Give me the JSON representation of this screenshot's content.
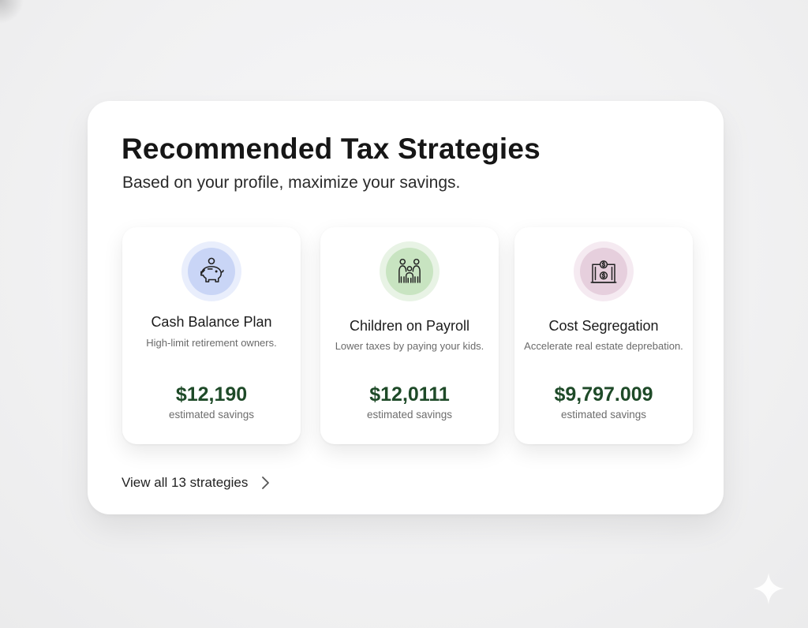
{
  "panel": {
    "title": "Recommended Tax Strategies",
    "subtitle": "Based on your profile, maximize your savings."
  },
  "strategies": [
    {
      "name": "Cash Balance Plan",
      "description": "High-limit retirement owners.",
      "amount": "$12,190",
      "caption": "estimated savings",
      "icon": "piggy-bank-icon",
      "accent": "#c9d5f6"
    },
    {
      "name": "Children on Payroll",
      "description": "Lower taxes by paying your kids.",
      "amount": "$12,0111",
      "caption": "estimated savings",
      "icon": "family-icon",
      "accent": "#c8e4c1"
    },
    {
      "name": "Cost Segregation",
      "description": "Accelerate real estate deprebation.",
      "amount": "$9,797.009",
      "caption": "estimated savings",
      "icon": "building-dollar-icon",
      "accent": "#e6cfdd"
    }
  ],
  "footer": {
    "view_all_label": "View all 13 strategies",
    "icon": "chevron-right-icon"
  },
  "colors": {
    "amount": "#1e4a28",
    "panel_background": "#ffffff",
    "page_background": "#f1f1f2"
  }
}
